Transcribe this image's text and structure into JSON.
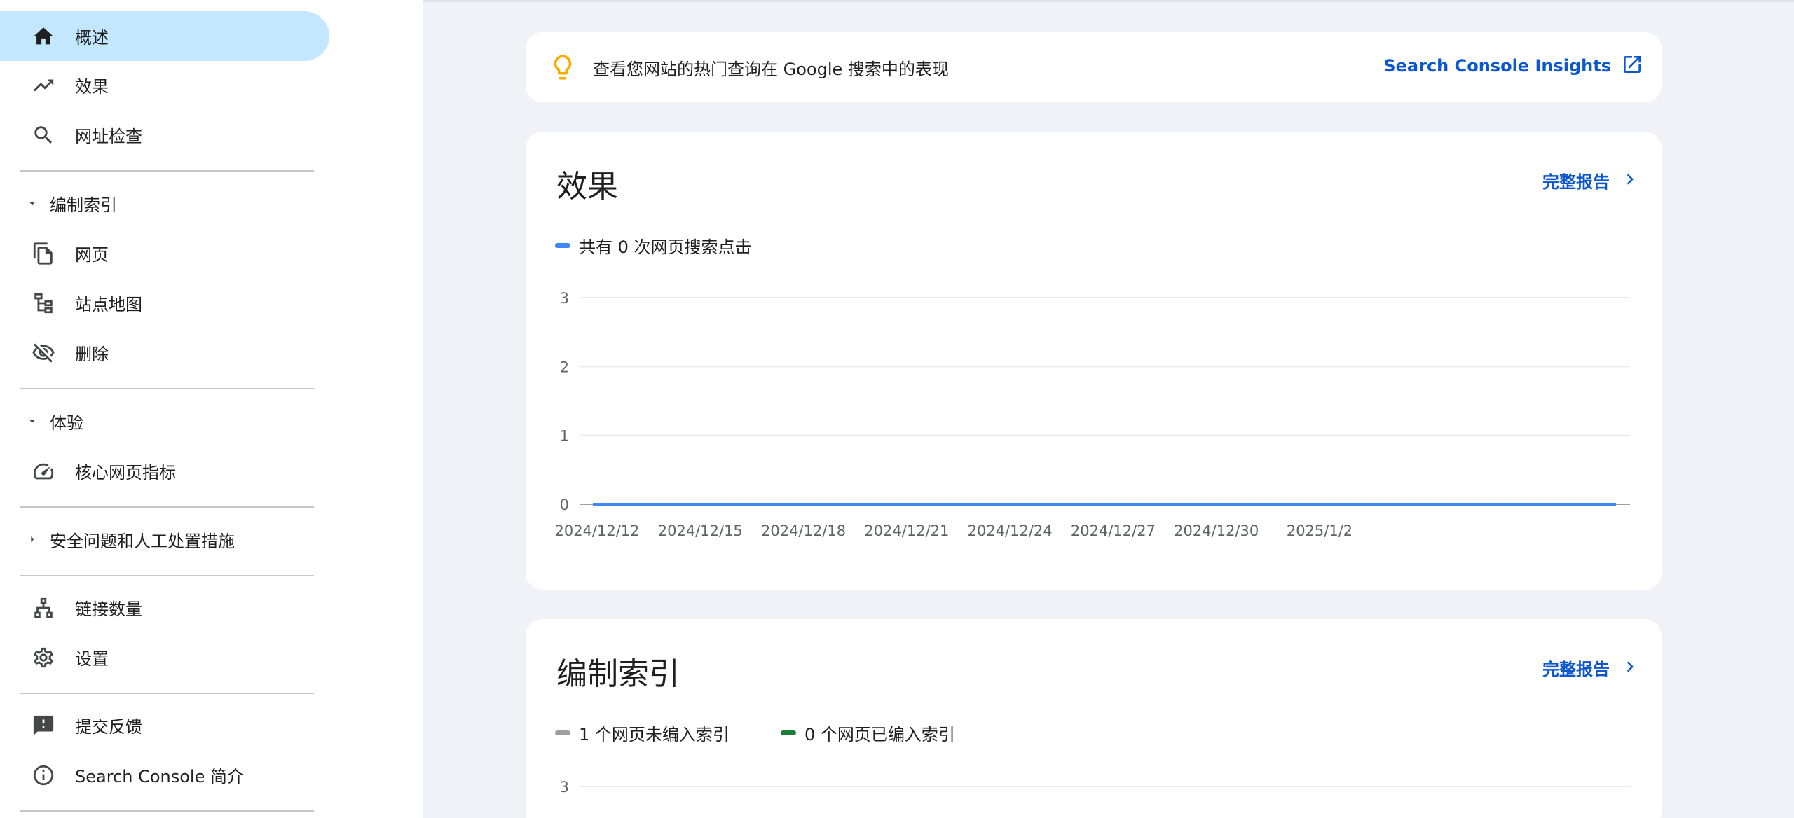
{
  "sidebar": {
    "items": [
      {
        "id": "overview",
        "label": "概述",
        "icon": "home-icon",
        "active": true
      },
      {
        "id": "performance",
        "label": "效果",
        "icon": "trending-up-icon"
      },
      {
        "id": "url-inspection",
        "label": "网址检查",
        "icon": "search-icon"
      }
    ],
    "indexing": {
      "header": "编制索引",
      "items": [
        {
          "id": "pages",
          "label": "网页",
          "icon": "pages-icon"
        },
        {
          "id": "sitemaps",
          "label": "站点地图",
          "icon": "sitemap-icon"
        },
        {
          "id": "removals",
          "label": "删除",
          "icon": "visibility-off-icon"
        }
      ]
    },
    "experience": {
      "header": "体验",
      "items": [
        {
          "id": "core-web-vitals",
          "label": "核心网页指标",
          "icon": "speed-icon"
        }
      ]
    },
    "security": {
      "header": "安全问题和人工处置措施"
    },
    "links": {
      "label": "链接数量",
      "icon": "links-icon"
    },
    "settings": {
      "label": "设置",
      "icon": "gear-icon"
    },
    "feedback": {
      "label": "提交反馈",
      "icon": "feedback-icon"
    },
    "about": {
      "label": "Search Console 简介",
      "icon": "info-icon"
    }
  },
  "insight": {
    "text": "查看您网站的热门查询在 Google 搜索中的表现",
    "link": "Search Console Insights",
    "icon": "lightbulb-icon"
  },
  "performance": {
    "title": "效果",
    "report_link": "完整报告",
    "legend": "共有 0 次网页搜索点击"
  },
  "indexing_card": {
    "title": "编制索引",
    "report_link": "完整报告",
    "legend_not_indexed": "1 个网页未编入索引",
    "legend_indexed": "0 个网页已编入索引",
    "y_top_tick": "3"
  },
  "colors": {
    "accent": "#0b57d0",
    "clicks_line": "#4285f4",
    "active_nav_bg": "#c2e7ff",
    "not_indexed": "#9e9e9e",
    "indexed": "#188038",
    "bulb": "#f9ab00"
  },
  "chart_data": [
    {
      "type": "line",
      "title": "效果",
      "x_tick_labels": [
        "2024/12/12",
        "2024/12/15",
        "2024/12/18",
        "2024/12/21",
        "2024/12/24",
        "2024/12/27",
        "2024/12/30",
        "2025/1/2"
      ],
      "y_ticks": [
        0,
        1,
        2,
        3
      ],
      "ylim": [
        0,
        3
      ],
      "grid": true,
      "series": [
        {
          "name": "共有 0 次网页搜索点击",
          "x": [
            "2024/12/12",
            "2025/1/2"
          ],
          "values": [
            0,
            0
          ]
        }
      ]
    }
  ]
}
